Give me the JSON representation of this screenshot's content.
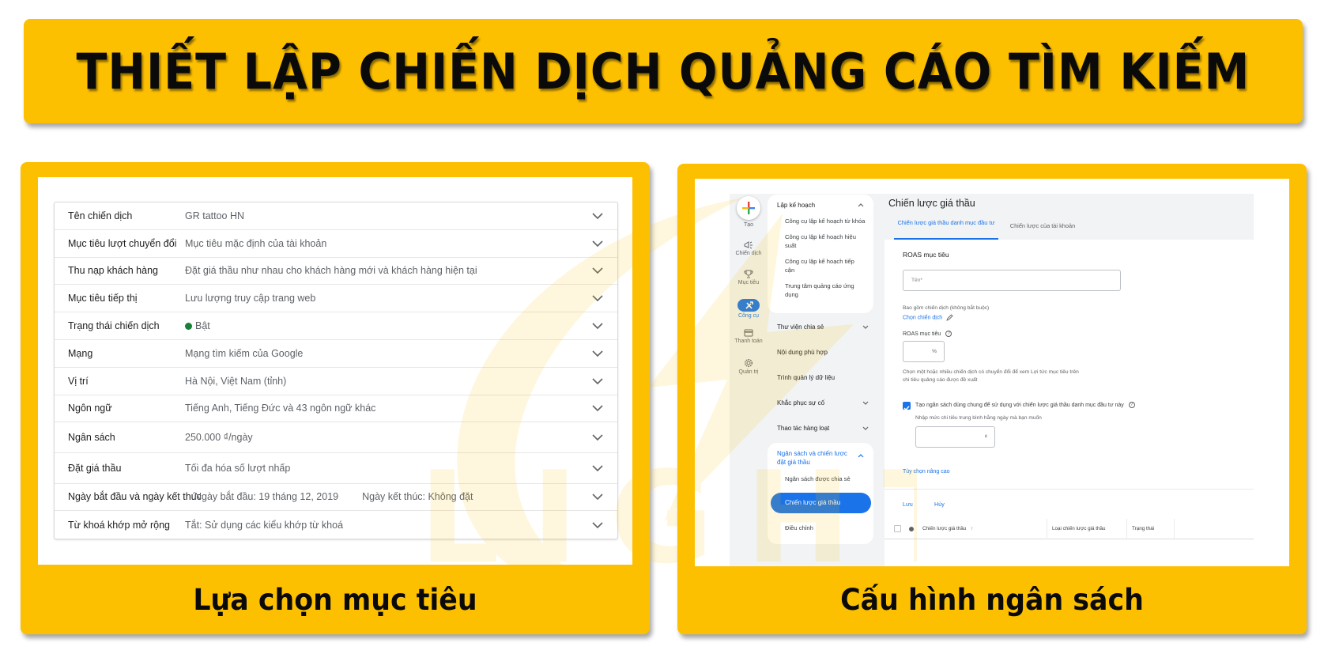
{
  "banner": {
    "title": "THIẾT LẬP CHIẾN DỊCH QUẢNG CÁO TÌM KIẾM"
  },
  "colors": {
    "brand_yellow": "#fdc000",
    "google_blue": "#1a73e8",
    "status_green": "#188038"
  },
  "left_card": {
    "caption": "Lựa chọn mục tiêu",
    "settings": [
      {
        "label": "Tên chiến dịch",
        "value": "GR tattoo HN",
        "icon": "chevron-down-icon"
      },
      {
        "label": "Mục tiêu lượt chuyển đổi",
        "value": "Mục tiêu mặc định của tài khoản",
        "icon": "chevron-down-icon"
      },
      {
        "label": "Thu nạp khách hàng",
        "value": "Đặt giá thầu như nhau cho khách hàng mới và khách hàng hiện tại",
        "icon": "chevron-down-icon"
      },
      {
        "label": "Mục tiêu tiếp thị",
        "value": "Lưu lượng truy cập trang web",
        "icon": "chevron-down-icon"
      },
      {
        "label": "Trạng thái chiến dịch",
        "value": "Bật",
        "status_icon": "green-dot-icon",
        "icon": "chevron-down-icon"
      },
      {
        "label": "Mạng",
        "value": "Mạng tìm kiếm của Google",
        "icon": "chevron-down-icon"
      },
      {
        "label": "Vị trí",
        "value": "Hà Nội, Việt Nam (tỉnh)",
        "icon": "chevron-down-icon"
      },
      {
        "label": "Ngôn ngữ",
        "value": "Tiếng Anh, Tiếng Đức và 43 ngôn ngữ khác",
        "icon": "chevron-down-icon"
      },
      {
        "label": "Ngân sách",
        "value": "250.000 ₫/ngày",
        "icon": "chevron-down-icon"
      },
      {
        "label": "Đặt giá thầu",
        "value": "Tối đa hóa số lượt nhấp",
        "icon": "chevron-down-icon"
      },
      {
        "label": "Ngày bắt đầu và ngày kết thúc",
        "value": "Ngày bắt đầu: 19 tháng 12, 2019",
        "value2": "Ngày kết thúc: Không đặt",
        "icon": "chevron-down-icon"
      },
      {
        "label": "Từ khoá khớp mở rộng",
        "value": "Tắt: Sử dụng các kiểu khớp từ khoá",
        "icon": "chevron-down-icon"
      }
    ]
  },
  "right_card": {
    "caption": "Cấu hình ngân sách",
    "nav_rail": [
      {
        "label": "Tạo",
        "icon": "plus-icon"
      },
      {
        "label": "Chiến dịch",
        "icon": "megaphone-icon"
      },
      {
        "label": "Mục tiêu",
        "icon": "trophy-icon"
      },
      {
        "label": "Công cụ",
        "icon": "tools-icon",
        "active": true
      },
      {
        "label": "Thanh toán",
        "icon": "credit-card-icon"
      },
      {
        "label": "Quản trị",
        "icon": "gear-icon"
      }
    ],
    "menu": {
      "planning": {
        "label": "Lập kế hoạch",
        "items": [
          "Công cụ lập kế hoạch từ khóa",
          "Công cụ lập kế hoạch hiệu suất",
          "Công cụ lập kế hoạch tiếp cận",
          "Trung tâm quảng cáo ứng dụng"
        ]
      },
      "shared_library": "Thư viện chia sẻ",
      "content_suitability": "Nội dung phù hợp",
      "data_manager": "Trình quản lý dữ liệu",
      "troubleshooting": "Khắc phục sự cố",
      "bulk_actions": "Thao tác hàng loạt",
      "budgets": {
        "label": "Ngân sách và chiến lược đặt giá thầu",
        "items": [
          "Ngân sách được chia sẻ",
          "Chiến lược giá thầu",
          "Điều chỉnh"
        ],
        "active_item": "Chiến lược giá thầu"
      }
    },
    "content": {
      "title": "Chiến lược giá thầu",
      "tabs": [
        "Chiến lược giá thầu danh mục đầu tư",
        "Chiến lược của tài khoản"
      ],
      "active_tab": 0,
      "section_title": "ROAS mục tiêu",
      "name_placeholder": "Tên*",
      "include_campaigns_label": "Bao gồm chiến dịch (không bắt buộc)",
      "select_campaigns_link": "Chọn chiến dịch",
      "target_roas_label": "ROAS mục tiêu",
      "target_roas_suffix": "%",
      "target_roas_value": "",
      "roas_hint": "Chọn một hoặc nhiều chiến dịch có chuyển đổi để xem Lợi tức mục tiêu trên chi tiêu quảng cáo được đề xuất",
      "shared_budget_checkbox": "Tạo ngân sách dùng chung để sử dụng với chiến lược giá thầu danh mục đầu tư này",
      "shared_budget_checked": true,
      "daily_spend_label": "Nhập mức chi tiêu trung bình hằng ngày mà bạn muốn",
      "currency_suffix": "₫",
      "daily_spend_value": "",
      "advanced_options_link": "Tùy chọn nâng cao",
      "save_button": "Lưu",
      "cancel_button": "Hủy",
      "table_headers": [
        "Chiến lược giá thầu",
        "Loại chiến lược giá thầu",
        "Trạng thái"
      ]
    }
  }
}
